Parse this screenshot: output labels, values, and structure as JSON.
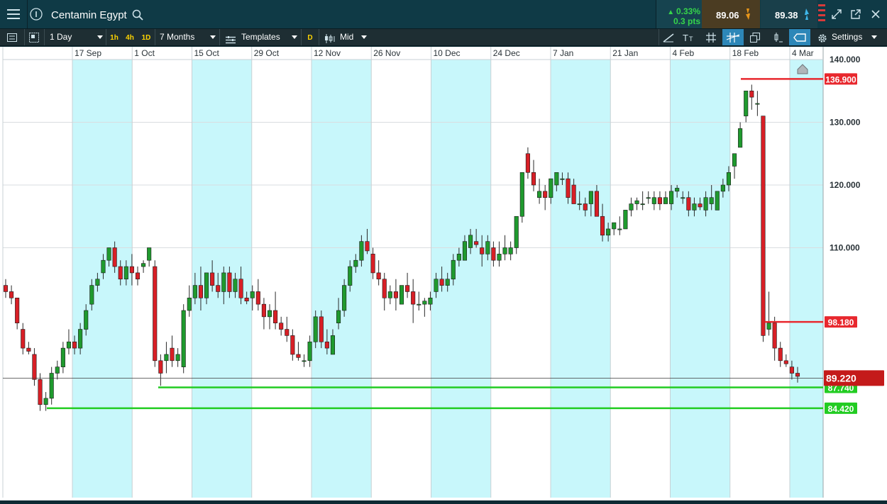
{
  "header": {
    "title": "Centamin Egypt",
    "change_pct": "0.33%",
    "change_pts": "0.3 pts",
    "sell_price": "89.06",
    "buy_price": "89.38"
  },
  "toolbar": {
    "interval": "1 Day",
    "quick_intervals": [
      "1h",
      "4h",
      "1D"
    ],
    "range": "7 Months",
    "templates": "Templates",
    "d_badge": "D",
    "price_mode": "Mid",
    "settings": "Settings"
  },
  "colors": {
    "up": "#1f9a2e",
    "down": "#d81f26",
    "accent": "#2d87b8",
    "band": "#c8f7fb",
    "support": "#22cc22",
    "resistance": "#e8282e"
  },
  "chart_data": {
    "type": "candlestick",
    "x_axis_labels": [
      "17 Sep",
      "1 Oct",
      "15 Oct",
      "29 Oct",
      "12 Nov",
      "26 Nov",
      "10 Dec",
      "24 Dec",
      "7 Jan",
      "21 Jan",
      "4 Feb",
      "18 Feb",
      "4 Mar"
    ],
    "y_ticks": [
      140,
      130,
      120,
      110
    ],
    "ylim": [
      75,
      142
    ],
    "current_price": {
      "value": 89.22,
      "label": "89.220"
    },
    "levels": [
      {
        "value": 136.9,
        "label": "136.900",
        "kind": "resistance"
      },
      {
        "value": 98.18,
        "label": "98.180",
        "kind": "resistance"
      },
      {
        "value": 87.74,
        "label": "87.740",
        "kind": "support"
      },
      {
        "value": 84.42,
        "label": "84.420",
        "kind": "support"
      }
    ],
    "ohlc": [
      [
        104,
        105,
        102,
        103
      ],
      [
        103,
        104,
        101,
        102
      ],
      [
        102,
        102,
        97,
        98
      ],
      [
        97,
        98,
        93,
        94
      ],
      [
        94,
        95,
        93,
        93.5
      ],
      [
        93,
        94,
        88,
        89
      ],
      [
        89,
        90,
        84,
        85
      ],
      [
        85,
        87,
        84,
        86
      ],
      [
        86,
        91,
        85,
        90
      ],
      [
        90,
        92,
        89,
        91
      ],
      [
        91,
        95,
        90,
        94
      ],
      [
        94,
        97,
        93,
        95
      ],
      [
        95,
        96,
        93,
        94
      ],
      [
        94,
        98,
        93,
        97
      ],
      [
        97,
        101,
        96,
        100
      ],
      [
        101,
        105,
        100,
        104
      ],
      [
        104,
        106,
        103,
        105
      ],
      [
        106,
        109,
        105,
        108
      ],
      [
        108,
        110,
        107,
        110
      ],
      [
        110,
        111,
        106,
        107
      ],
      [
        107,
        108,
        104,
        105
      ],
      [
        105,
        108,
        104,
        107
      ],
      [
        107,
        109,
        104,
        106
      ],
      [
        106,
        107,
        104,
        105
      ],
      [
        107,
        108,
        106,
        107.5
      ],
      [
        108,
        110,
        107,
        110
      ],
      [
        107,
        108,
        91,
        92
      ],
      [
        92,
        93,
        88,
        90
      ],
      [
        92,
        95,
        90,
        93
      ],
      [
        94,
        96,
        91,
        92
      ],
      [
        92,
        94,
        91,
        93
      ],
      [
        91,
        101,
        90,
        100
      ],
      [
        100,
        104,
        99,
        102
      ],
      [
        102,
        106,
        101,
        104
      ],
      [
        104,
        107,
        100,
        102
      ],
      [
        102,
        106,
        101,
        106
      ],
      [
        106,
        108,
        103,
        104
      ],
      [
        104,
        106,
        102,
        103
      ],
      [
        103,
        107,
        101,
        106
      ],
      [
        106,
        107,
        102,
        103
      ],
      [
        103,
        106,
        102,
        105
      ],
      [
        105,
        107,
        101,
        102
      ],
      [
        102,
        103,
        101,
        101.5
      ],
      [
        102,
        104,
        100,
        103
      ],
      [
        103,
        105,
        100,
        101
      ],
      [
        101,
        102,
        97,
        99
      ],
      [
        99,
        101,
        97,
        100
      ],
      [
        100,
        103,
        97,
        98
      ],
      [
        98,
        99,
        96,
        97
      ],
      [
        97,
        99,
        95,
        96
      ],
      [
        96,
        97,
        92,
        93
      ],
      [
        93,
        95,
        92,
        92.5
      ],
      [
        92,
        93,
        91,
        92
      ],
      [
        92,
        96,
        91,
        95
      ],
      [
        95,
        100,
        94,
        99
      ],
      [
        99,
        100,
        94,
        95
      ],
      [
        95,
        97,
        93,
        94
      ],
      [
        93,
        97,
        93,
        96
      ],
      [
        98,
        102,
        97,
        100
      ],
      [
        100,
        105,
        99,
        104
      ],
      [
        104,
        108,
        103,
        107
      ],
      [
        107,
        109,
        106,
        108
      ],
      [
        108,
        112,
        107,
        111
      ],
      [
        111,
        113,
        109,
        109.5
      ],
      [
        109,
        110,
        105,
        106
      ],
      [
        106,
        108,
        104,
        105
      ],
      [
        105,
        106,
        100,
        102
      ],
      [
        102,
        104,
        101,
        103
      ],
      [
        103,
        105,
        100,
        102
      ],
      [
        101,
        104,
        101,
        104
      ],
      [
        104,
        106,
        102,
        103
      ],
      [
        103,
        105,
        98,
        101
      ],
      [
        101,
        103,
        100,
        101
      ],
      [
        101,
        102,
        99,
        101.5
      ],
      [
        101,
        103,
        100,
        102
      ],
      [
        103,
        106,
        102,
        105
      ],
      [
        105,
        107,
        103,
        104
      ],
      [
        104,
        106,
        103,
        105
      ],
      [
        105,
        109,
        104,
        108
      ],
      [
        108,
        110,
        107,
        109
      ],
      [
        108,
        112,
        108,
        111
      ],
      [
        110,
        113,
        109,
        112
      ],
      [
        111,
        113,
        110,
        110.5
      ],
      [
        110,
        112,
        107,
        109
      ],
      [
        109,
        112,
        108,
        111
      ],
      [
        110,
        111,
        107,
        108
      ],
      [
        108,
        111,
        107,
        109
      ],
      [
        109,
        112,
        108,
        110
      ],
      [
        109,
        111,
        108,
        110
      ],
      [
        110,
        115,
        109,
        115
      ],
      [
        115,
        122,
        114,
        122
      ],
      [
        125,
        126,
        121,
        122
      ],
      [
        122,
        124,
        119,
        120
      ],
      [
        118,
        121,
        117,
        119
      ],
      [
        119,
        120,
        116,
        118
      ],
      [
        118,
        121,
        117,
        121
      ],
      [
        120,
        122,
        119,
        122
      ],
      [
        121,
        122,
        120,
        121
      ],
      [
        121,
        122,
        117,
        118
      ],
      [
        120,
        121,
        117,
        117
      ],
      [
        117,
        119,
        116,
        117
      ],
      [
        117,
        118,
        115,
        116
      ],
      [
        117,
        119,
        115,
        119
      ],
      [
        119,
        120,
        115,
        115
      ],
      [
        115,
        117,
        111,
        112
      ],
      [
        112,
        114,
        111,
        113
      ],
      [
        113,
        114,
        112,
        114
      ],
      [
        113,
        115,
        112,
        113
      ],
      [
        113,
        116,
        113,
        116
      ],
      [
        116,
        118,
        115,
        117
      ],
      [
        117,
        118,
        116,
        117.5
      ],
      [
        117,
        119,
        116,
        117
      ],
      [
        118,
        119,
        117,
        118
      ],
      [
        117,
        119,
        116,
        118
      ],
      [
        118,
        119,
        116,
        117
      ],
      [
        117,
        119,
        117,
        118
      ],
      [
        117,
        120,
        116,
        119
      ],
      [
        119,
        120,
        118,
        119.5
      ],
      [
        118,
        119,
        117,
        118
      ],
      [
        118,
        119,
        115,
        116
      ],
      [
        116,
        118,
        115,
        117
      ],
      [
        117,
        118,
        116,
        116.5
      ],
      [
        116,
        119,
        115,
        118
      ],
      [
        117,
        120,
        116,
        118
      ],
      [
        116,
        119,
        116,
        119
      ],
      [
        119,
        121,
        118,
        120
      ],
      [
        120,
        123,
        119,
        122
      ],
      [
        123,
        125,
        121,
        125
      ],
      [
        126,
        130,
        126,
        129
      ],
      [
        131,
        135,
        130,
        135
      ],
      [
        135,
        136,
        132,
        134
      ],
      [
        133,
        135,
        131,
        133
      ],
      [
        131,
        131,
        95,
        96
      ],
      [
        97,
        103,
        96,
        98
      ],
      [
        98,
        99,
        92,
        94
      ],
      [
        94,
        95,
        91,
        92
      ],
      [
        92,
        93,
        91,
        91.5
      ],
      [
        91,
        92,
        89,
        90
      ],
      [
        90,
        91,
        88.5,
        89.5
      ]
    ]
  }
}
